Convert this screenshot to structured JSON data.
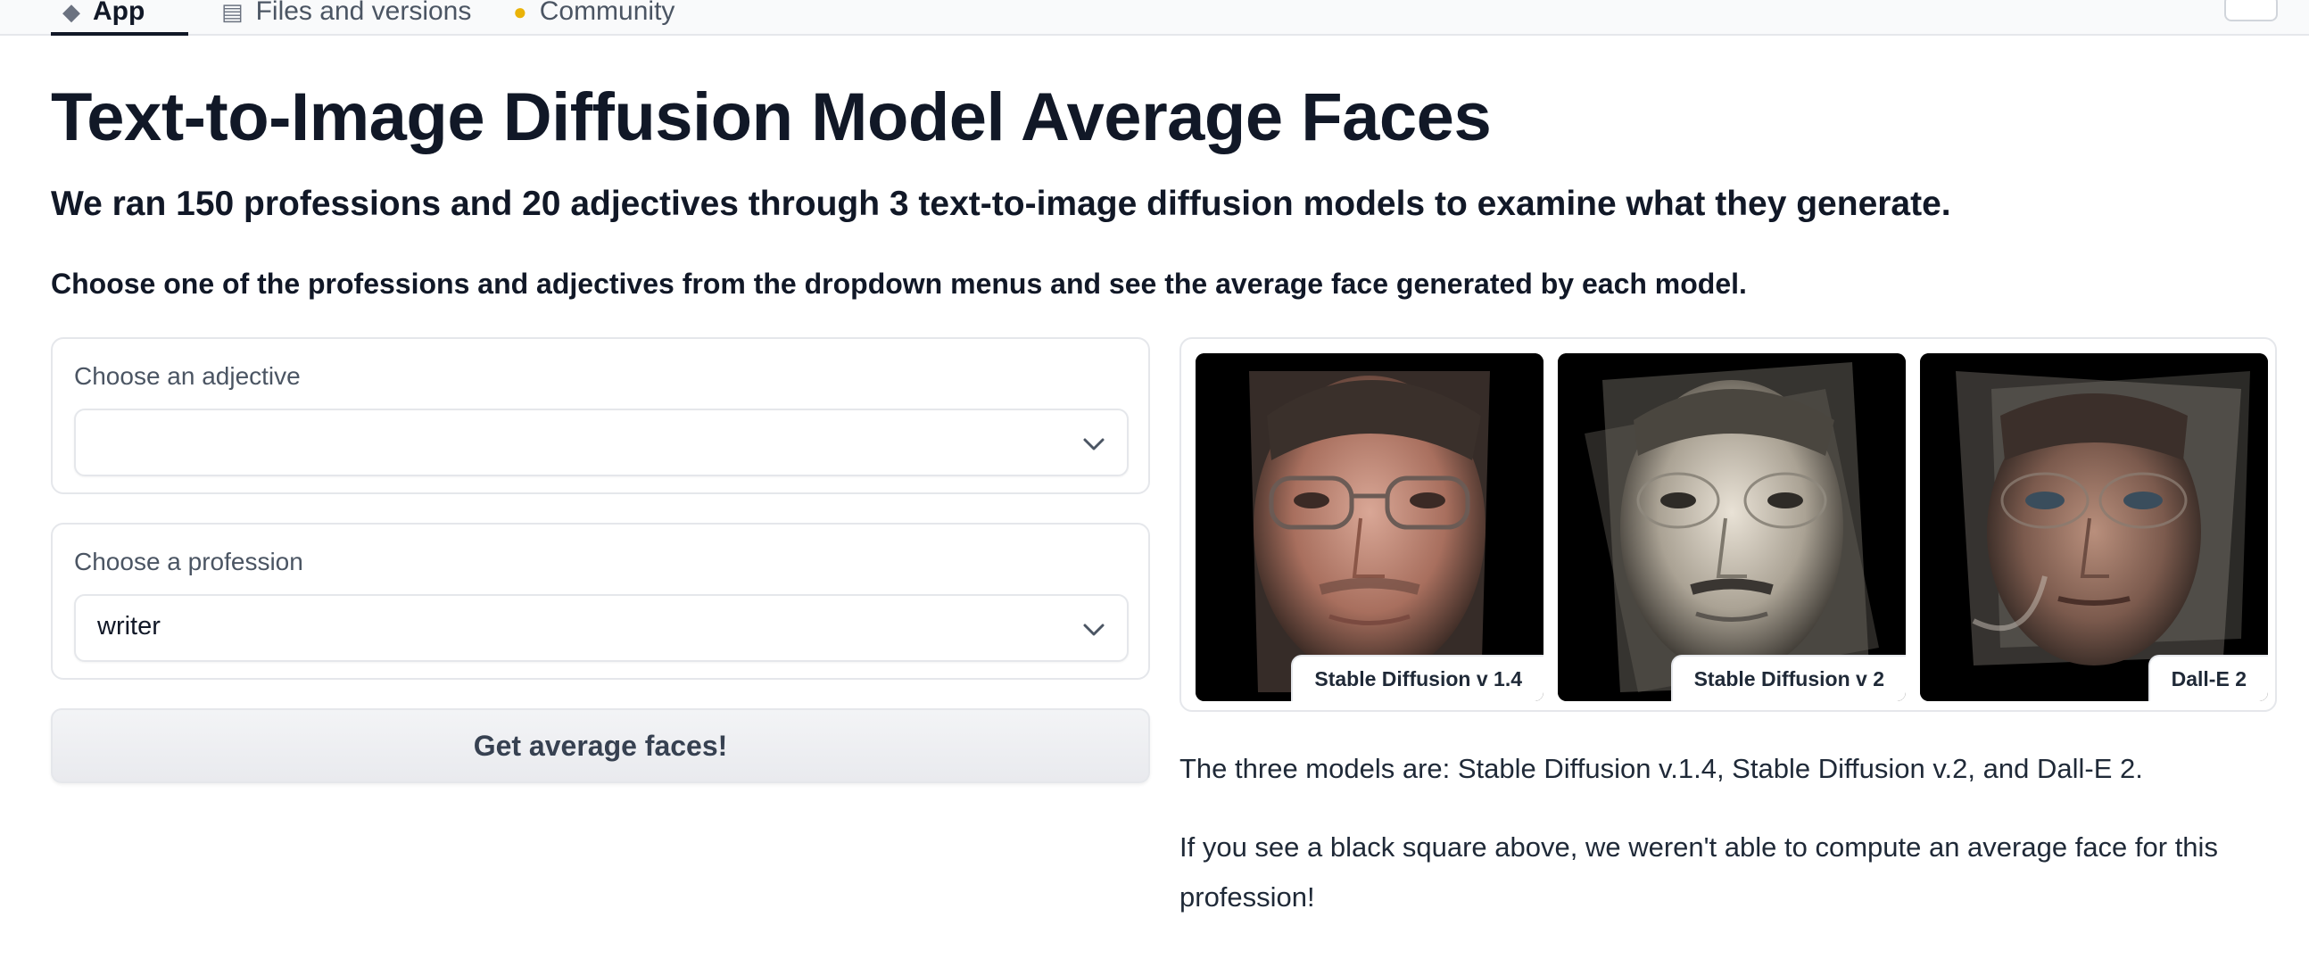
{
  "tabs": [
    {
      "label": "App",
      "icon": "cube-icon"
    },
    {
      "label": "Files and versions",
      "icon": "file-icon"
    },
    {
      "label": "Community",
      "icon": "chat-icon"
    }
  ],
  "page": {
    "title": "Text-to-Image Diffusion Model Average Faces",
    "subtitle": "We ran 150 professions and 20 adjectives through 3 text-to-image diffusion models to examine what they generate.",
    "instructions": "Choose one of the professions and adjectives from the dropdown menus and see the average face generated by each model."
  },
  "adjective": {
    "label": "Choose an adjective",
    "value": ""
  },
  "profession": {
    "label": "Choose a profession",
    "value": "writer"
  },
  "submit_label": "Get average faces!",
  "gallery": [
    {
      "caption": "Stable Diffusion v 1.4",
      "tone": "color"
    },
    {
      "caption": "Stable Diffusion v 2",
      "tone": "sepia"
    },
    {
      "caption": "Dall-E 2",
      "tone": "color"
    }
  ],
  "notes": {
    "models": "The three models are: Stable Diffusion v.1.4, Stable Diffusion v.2, and Dall-E 2.",
    "black_square": "If you see a black square above, we weren't able to compute an average face for this profession!"
  },
  "colors": {
    "accent": "#111827",
    "border": "#e5e7eb",
    "muted": "#4b5563"
  }
}
